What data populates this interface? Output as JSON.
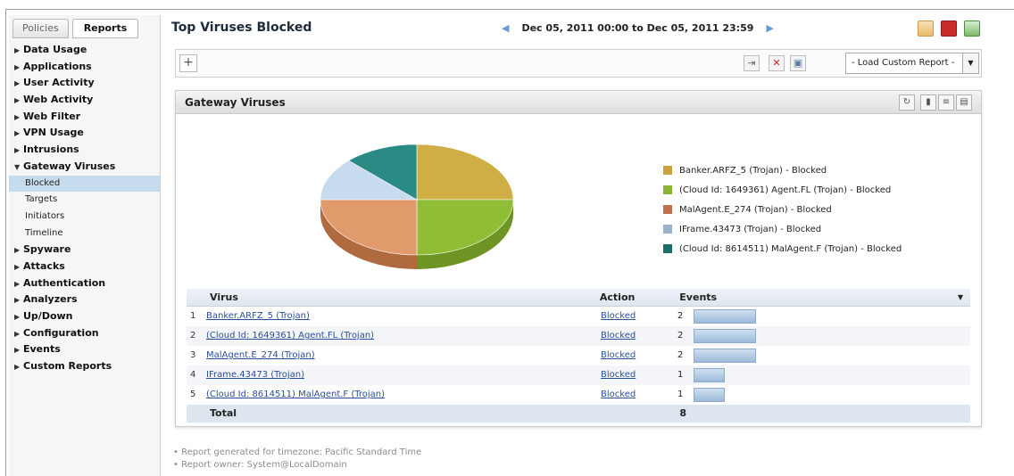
{
  "sidebar": {
    "tabs": [
      {
        "label": "Policies",
        "active": false
      },
      {
        "label": "Reports",
        "active": true
      }
    ],
    "items": [
      {
        "label": "Data Usage",
        "type": "section"
      },
      {
        "label": "Applications",
        "type": "section"
      },
      {
        "label": "User Activity",
        "type": "section"
      },
      {
        "label": "Web Activity",
        "type": "section"
      },
      {
        "label": "Web Filter",
        "type": "section"
      },
      {
        "label": "VPN Usage",
        "type": "section"
      },
      {
        "label": "Intrusions",
        "type": "section"
      },
      {
        "label": "Gateway Viruses",
        "type": "section-open"
      },
      {
        "label": "Blocked",
        "type": "sub",
        "active": true
      },
      {
        "label": "Targets",
        "type": "sub"
      },
      {
        "label": "Initiators",
        "type": "sub"
      },
      {
        "label": "Timeline",
        "type": "sub"
      },
      {
        "label": "Spyware",
        "type": "section"
      },
      {
        "label": "Attacks",
        "type": "section"
      },
      {
        "label": "Authentication",
        "type": "section"
      },
      {
        "label": "Analyzers",
        "type": "section"
      },
      {
        "label": "Up/Down",
        "type": "section"
      },
      {
        "label": "Configuration",
        "type": "section"
      },
      {
        "label": "Events",
        "type": "section"
      },
      {
        "label": "Custom Reports",
        "type": "section"
      }
    ]
  },
  "header": {
    "title": "Top Viruses Blocked",
    "date_range": "Dec 05, 2011 00:00 to Dec 05, 2011 23:59"
  },
  "filterbar": {
    "add_label": "+",
    "load_report_label": "- Load Custom Report -"
  },
  "panel": {
    "title": "Gateway Viruses"
  },
  "legend": [
    {
      "label": "Banker.ARFZ_5 (Trojan) - Blocked",
      "color": "#c8a43a"
    },
    {
      "label": "(Cloud Id: 1649361) Agent.FL (Trojan) - Blocked",
      "color": "#8cb332"
    },
    {
      "label": "MalAgent.E_274 (Trojan) - Blocked",
      "color": "#c0704a"
    },
    {
      "label": "IFrame.43473 (Trojan) - Blocked",
      "color": "#9bb3cc"
    },
    {
      "label": "(Cloud Id: 8614511) MalAgent.F (Trojan) - Blocked",
      "color": "#1d6e68"
    }
  ],
  "chart_data": {
    "type": "pie",
    "categories": [
      "Banker.ARFZ_5 (Trojan) - Blocked",
      "(Cloud Id: 1649361) Agent.FL (Trojan) - Blocked",
      "MalAgent.E_274 (Trojan) - Blocked",
      "IFrame.43473 (Trojan) - Blocked",
      "(Cloud Id: 8614511) MalAgent.F (Trojan) - Blocked"
    ],
    "values": [
      2,
      2,
      2,
      1,
      1
    ],
    "colors": [
      "#cfae45",
      "#90bd36",
      "#e09a6c",
      "#c7dbee",
      "#2a8a84"
    ],
    "side_colors": [
      "#a4842a",
      "#6e9424",
      "#b06a40",
      "#94a9bf",
      "#1a5e59"
    ]
  },
  "table": {
    "headers": {
      "virus": "Virus",
      "action": "Action",
      "events": "Events"
    },
    "sort_indicator": "▼",
    "rows": [
      {
        "num": "1",
        "virus": "Banker.ARFZ_5 (Trojan)",
        "action": "Blocked",
        "events": "2",
        "events_value": 2
      },
      {
        "num": "2",
        "virus": "(Cloud Id: 1649361) Agent.FL (Trojan)",
        "action": "Blocked",
        "events": "2",
        "events_value": 2
      },
      {
        "num": "3",
        "virus": "MalAgent.E_274 (Trojan)",
        "action": "Blocked",
        "events": "2",
        "events_value": 2
      },
      {
        "num": "4",
        "virus": "IFrame.43473 (Trojan)",
        "action": "Blocked",
        "events": "1",
        "events_value": 1
      },
      {
        "num": "5",
        "virus": "(Cloud Id: 8614511) MalAgent.F (Trojan)",
        "action": "Blocked",
        "events": "1",
        "events_value": 1
      }
    ],
    "total_label": "Total",
    "total_value": "8",
    "events_max": 2
  },
  "footer": {
    "timezone": "• Report generated for timezone: Pacific Standard Time",
    "owner": "• Report owner: System@LocalDomain"
  }
}
